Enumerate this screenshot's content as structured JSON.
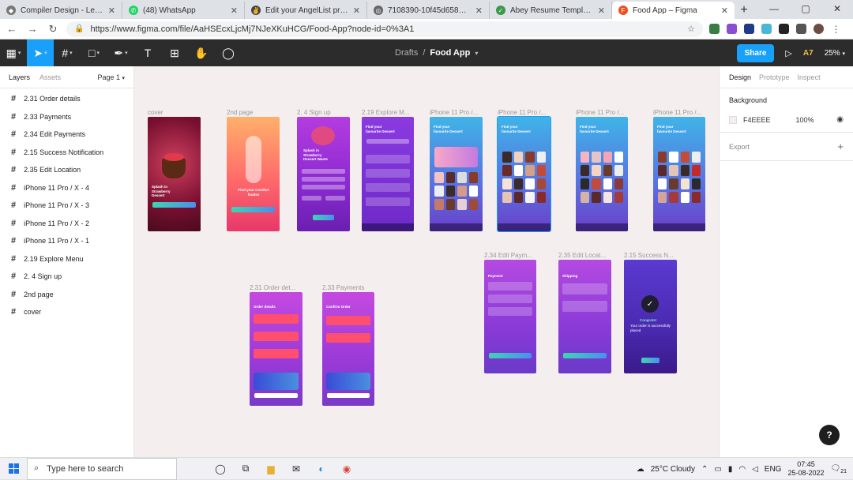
{
  "browser": {
    "tabs": [
      {
        "title": "Compiler Design - Lexical An...",
        "color": "#666"
      },
      {
        "title": "(48) WhatsApp",
        "color": "#25d366"
      },
      {
        "title": "Edit your AngelList profile | A...",
        "color": "#444"
      },
      {
        "title": "7108390-10f45d6581f4d76c...",
        "color": "#555"
      },
      {
        "title": "Abey Resume Template - Onl...",
        "color": "#3a9a4a"
      },
      {
        "title": "Food App – Figma",
        "color": "#f24e1e"
      }
    ],
    "new_tab": "+",
    "url": "https://www.figma.com/file/AaHSEcxLjcMj7NJeXKuHCG/Food-App?node-id=0%3A1",
    "window": {
      "minimize": "—",
      "maximize": "▢",
      "close": "✕"
    }
  },
  "figma": {
    "breadcrumb": {
      "drafts": "Drafts",
      "separator": "/",
      "file": "Food App"
    },
    "share_label": "Share",
    "user_initials": "A7",
    "zoom": "25%",
    "left": {
      "tabs": {
        "layers": "Layers",
        "assets": "Assets",
        "page": "Page 1"
      },
      "layers": [
        "2.31 Order details",
        "2.33 Payments",
        "2.34 Edit Payments",
        "2.15 Success Notification",
        "2.35 Edit Location",
        "iPhone 11 Pro / X - 4",
        "iPhone 11 Pro / X - 3",
        "iPhone 11 Pro / X - 2",
        "iPhone 11 Pro / X - 1",
        "2.19 Explore Menu",
        "2. 4 Sign up",
        "2nd page",
        "cover"
      ]
    },
    "right": {
      "tabs": {
        "design": "Design",
        "prototype": "Prototype",
        "inspect": "Inspect"
      },
      "background_label": "Background",
      "background_hex": "F4EEEE",
      "background_opacity": "100%",
      "export_label": "Export"
    },
    "frames": {
      "cover": {
        "label": "cover",
        "title": "Splash in Strawberry Dessert"
      },
      "second": {
        "label": "2nd page",
        "title": "Find your Comfort foodss"
      },
      "signup": {
        "label": "2. 4 Sign up",
        "title": "Splash in Strawberry Dessert Waste"
      },
      "explore": {
        "label": "2.19 Explore M...",
        "title": "Find your favourite Dessert"
      },
      "iph1": {
        "label": "iPhone 11 Pro /...",
        "title": "Find your favourite Dessert"
      },
      "iph2": {
        "label": "iPhone 11 Pro /...",
        "title": "Find your favourite Dessert"
      },
      "iph3": {
        "label": "iPhone 11 Pro /...",
        "title": "Find your favourite Dessert"
      },
      "iph4": {
        "label": "iPhone 11 Pro /...",
        "title": "Find your favourite Dessert"
      },
      "editpay": {
        "label": "2.34 Edit Paym...",
        "title": "Payment"
      },
      "editloc": {
        "label": "2.35 Edit Locat...",
        "title": "Shipping"
      },
      "success": {
        "label": "2.15 Success N...",
        "title": "Congrats!",
        "sub": "Your order is successfully placed"
      },
      "order": {
        "label": "2.31 Order det...",
        "title": "Order details"
      },
      "payments": {
        "label": "2.33 Payments",
        "title": "Confirm Order"
      }
    },
    "help": "?"
  },
  "taskbar": {
    "search_placeholder": "Type here to search",
    "weather": "25°C  Cloudy",
    "lang": "ENG",
    "time": "07:45",
    "date": "25-08-2022",
    "notif": "21"
  }
}
